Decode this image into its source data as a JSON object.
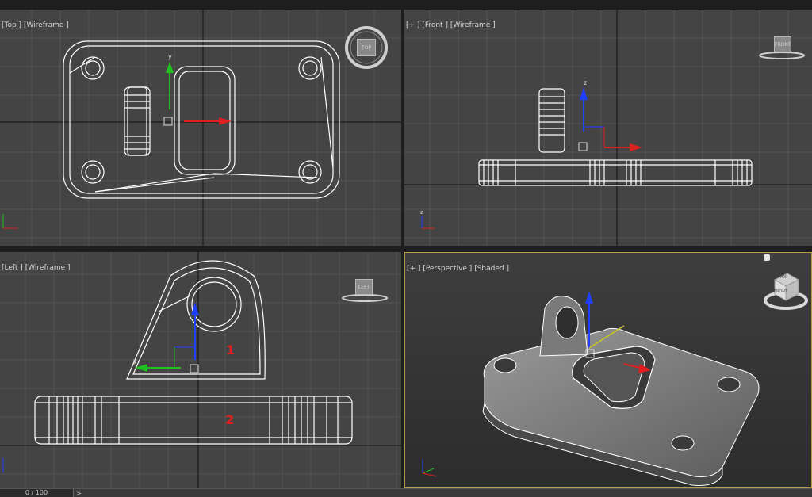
{
  "viewports": {
    "top": {
      "plus": "",
      "name": "[Top ]",
      "mode": "[Wireframe ]",
      "cube": "TOP"
    },
    "front": {
      "plus": "[+ ]",
      "name": "[Front ]",
      "mode": "[Wireframe ]",
      "cube": "FRONT"
    },
    "left": {
      "plus": "",
      "name": "[Left ]",
      "mode": "[Wireframe ]",
      "cube": "LEFT"
    },
    "perspective": {
      "plus": "[+ ]",
      "name": "[Perspective ]",
      "mode": "[Shaded ]",
      "cube_top": "TOP",
      "cube_front": "FRONT"
    }
  },
  "annotations": {
    "part_1": "1",
    "part_2": "2"
  },
  "timeline": {
    "frame": "0 / 100",
    "next_arrow": ">"
  },
  "axes": {
    "x": "x",
    "y": "y",
    "z": "z"
  },
  "colors": {
    "viewport_bg": "#444444",
    "grid": "#555555",
    "wire": "#ffffff",
    "active_border": "#b59a47",
    "annotation": "#e02020",
    "axis_x": "#ff0000",
    "axis_y": "#00c000",
    "axis_z": "#2040ff"
  },
  "icons": [
    "viewcube-icon",
    "gizmo-axis-icon",
    "pivot-box-icon",
    "lightbulb-icon"
  ]
}
